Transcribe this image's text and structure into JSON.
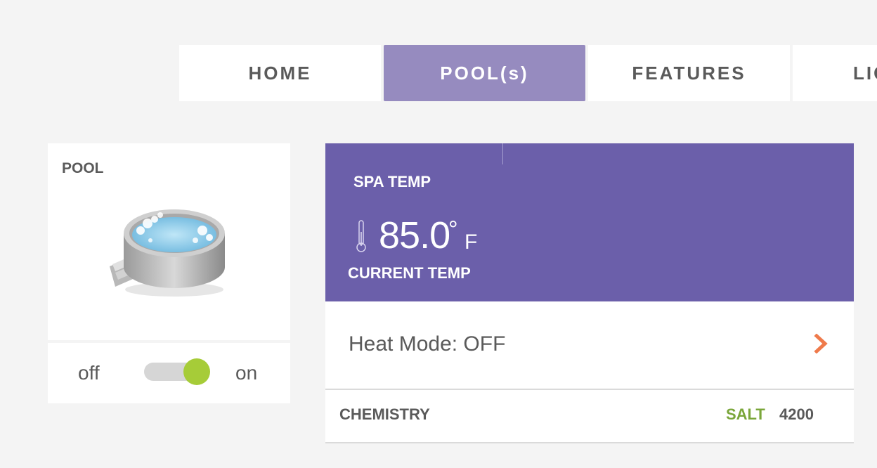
{
  "tabs": [
    {
      "label": "HOME",
      "active": false
    },
    {
      "label": "POOL(s)",
      "active": true
    },
    {
      "label": "FEATURES",
      "active": false
    },
    {
      "label": "LIG",
      "active": false
    }
  ],
  "pool_card": {
    "title": "POOL",
    "image_icon": "hot-tub-icon",
    "toggle": {
      "off_label": "off",
      "on_label": "on",
      "state": "on"
    }
  },
  "spa": {
    "title": "SPA TEMP",
    "temperature": "85.0",
    "degree_symbol": "°",
    "unit": "F",
    "current_label": "CURRENT TEMP",
    "thermometer_icon": "thermometer-icon"
  },
  "heat": {
    "label": "Heat Mode: OFF",
    "chevron_icon": "chevron-right-icon"
  },
  "chemistry": {
    "label": "CHEMISTRY",
    "salt_label": "SALT",
    "salt_value": "4200"
  },
  "colors": {
    "background": "#f4f4f4",
    "tab_active": "#968bbf",
    "spa_header": "#6b5faa",
    "toggle_on": "#a6cc38",
    "salt_green": "#7aa63a",
    "chevron_orange": "#ef7a4b"
  }
}
